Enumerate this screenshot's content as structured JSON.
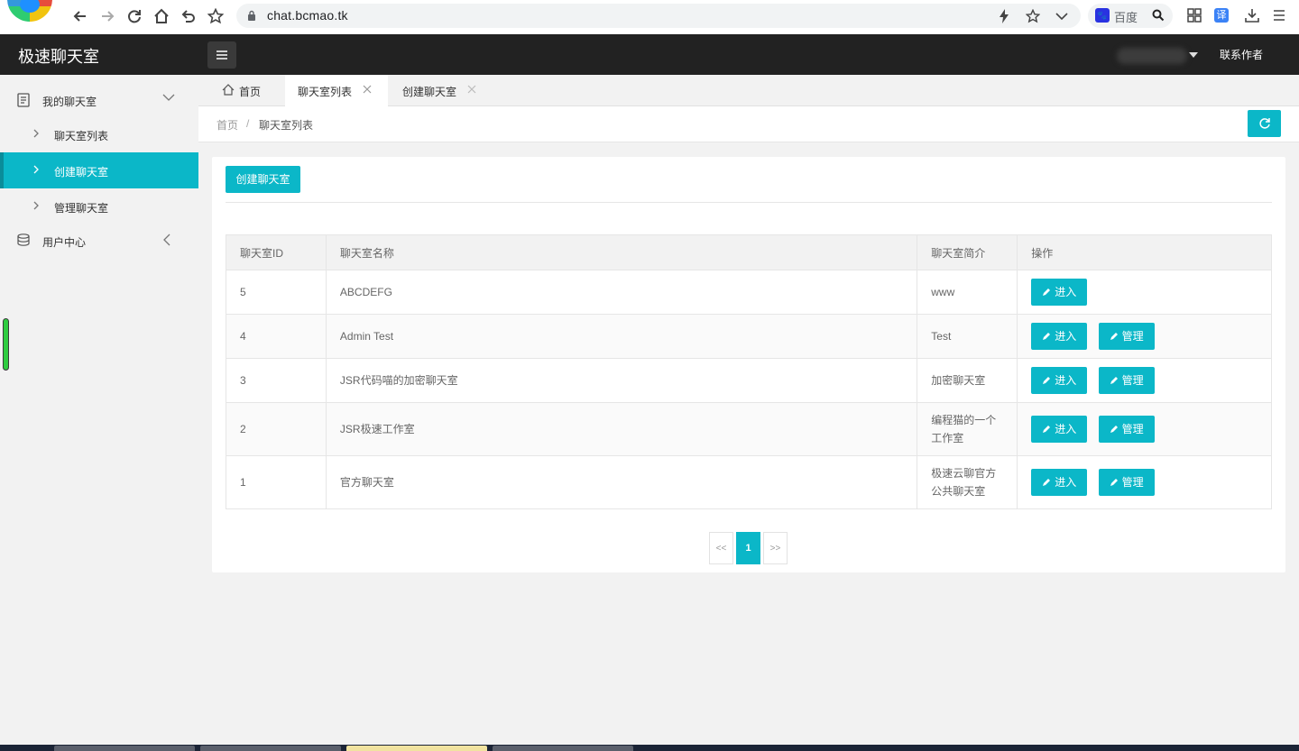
{
  "browser": {
    "url": "chat.bcmao.tk",
    "search_engine_label": "百度"
  },
  "header": {
    "app_title": "极速聊天室",
    "contact_label": "联系作者"
  },
  "sidebar": {
    "group_mychat": "我的聊天室",
    "items": [
      {
        "label": "聊天室列表"
      },
      {
        "label": "创建聊天室"
      },
      {
        "label": "管理聊天室"
      }
    ],
    "group_user": "用户中心"
  },
  "tabs": [
    {
      "label": "首页"
    },
    {
      "label": "聊天室列表"
    },
    {
      "label": "创建聊天室"
    }
  ],
  "breadcrumb": {
    "home": "首页",
    "separator": "/",
    "current": "聊天室列表"
  },
  "toolbar": {
    "create_label": "创建聊天室"
  },
  "table": {
    "headers": [
      "聊天室ID",
      "聊天室名称",
      "聊天室简介",
      "操作"
    ],
    "enter_label": "进入",
    "manage_label": "管理",
    "rows": [
      {
        "id": "5",
        "name": "ABCDEFG",
        "intro": "www"
      },
      {
        "id": "4",
        "name": "Admin Test",
        "intro": "Test"
      },
      {
        "id": "3",
        "name": "JSR代码喵的加密聊天室",
        "intro": "加密聊天室"
      },
      {
        "id": "2",
        "name": "JSR极速工作室",
        "intro": "编程猫的一个工作室"
      },
      {
        "id": "1",
        "name": "官方聊天室",
        "intro": "极速云聊官方公共聊天室"
      }
    ]
  },
  "pagination": {
    "prev": "<<",
    "current": "1",
    "next": ">>"
  },
  "colors": {
    "accent": "#0bb7c8",
    "header_bg": "#222222",
    "page_bg": "#f2f2f2"
  }
}
